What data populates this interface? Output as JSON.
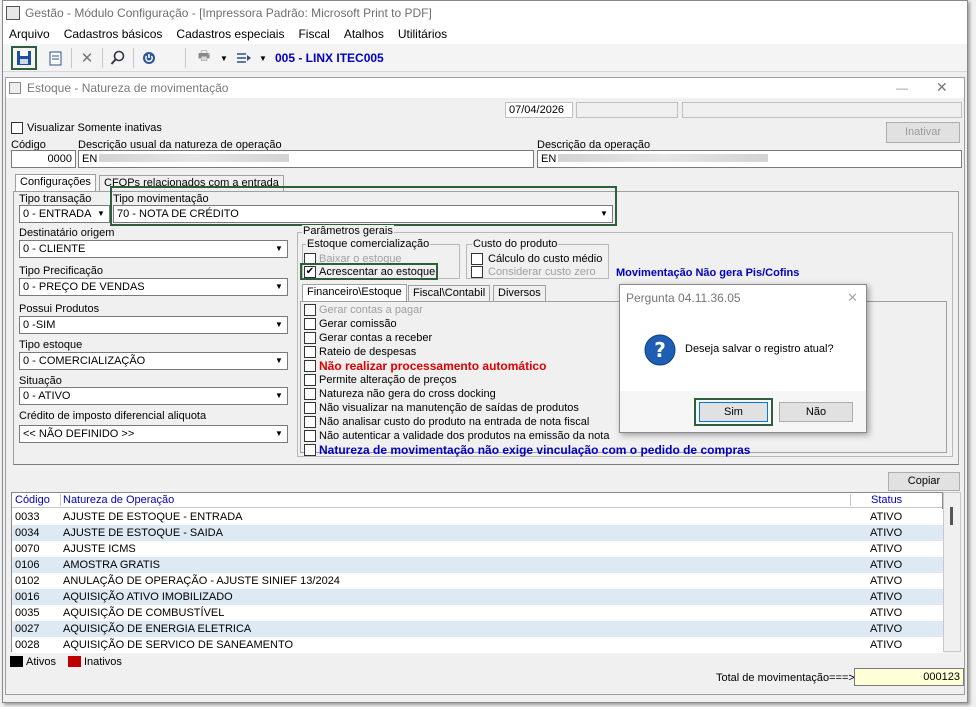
{
  "window": {
    "title": "Gestão - Módulo Configuração - [Impressora Padrão: Microsoft Print to PDF]"
  },
  "menu": [
    "Arquivo",
    "Cadastros básicos",
    "Cadastros especiais",
    "Fiscal",
    "Atalhos",
    "Utilitários"
  ],
  "toolbar": {
    "company": "005 - LINX ITEC005"
  },
  "child": {
    "title": "Estoque - Natureza de movimentação",
    "date": "07/04/2026"
  },
  "form": {
    "only_inactive": "Visualizar Somente inativas",
    "inactivate": "Inativar",
    "code_label": "Código",
    "code": "0000",
    "desc_usual_label": "Descrição usual da natureza de operação",
    "desc_usual": "EN",
    "desc_op_label": "Descrição da operação",
    "desc_op": "EN"
  },
  "tabs": {
    "config": "Configurações",
    "cfop": "CFOPs relacionados com a entrada"
  },
  "left": {
    "tipo_transacao_label": "Tipo transação",
    "tipo_transacao": "0 - ENTRADA",
    "tipo_mov_label": "Tipo movimentação",
    "tipo_mov": "70 - NOTA DE CRÉDITO",
    "dest_label": "Destinatário origem",
    "dest": "0 - CLIENTE",
    "prec_label": "Tipo Precificação",
    "prec": "0 - PREÇO DE VENDAS",
    "prod_label": "Possui Produtos",
    "prod": "0 -SIM",
    "estq_label": "Tipo estoque",
    "estq": "0 - COMERCIALIZAÇÃO",
    "sit_label": "Situação",
    "sit": "0 - ATIVO",
    "cred_label": "Crédito de imposto diferencial aliquota",
    "cred": "<< NÃO DEFINIDO >>"
  },
  "params": {
    "title": "Parâmetros gerais",
    "estoque_com": "Estoque comercialização",
    "baixar": "Baixar o estoque",
    "acrescentar": "Acrescentar ao estoque",
    "custo": "Custo do produto",
    "calc_custo": "Cálculo do custo médio",
    "cons_custo": "Considerar custo zero",
    "pis_note": "Movimentação Não gera Pis/Cofins"
  },
  "subtabs": [
    "Financeiro\\Estoque",
    "Fiscal\\Contabil",
    "Diversos"
  ],
  "checks": [
    {
      "label": "Gerar contas a pagar",
      "style": "grey"
    },
    {
      "label": "Gerar comissão",
      "style": "normal"
    },
    {
      "label": "Gerar contas a receber",
      "style": "normal"
    },
    {
      "label": "Rateio de despesas",
      "style": "normal"
    },
    {
      "label": "Não realizar processamento automático",
      "style": "red"
    },
    {
      "label": "Permite alteração de preços",
      "style": "normal"
    },
    {
      "label": "Natureza não gera do cross docking",
      "style": "normal"
    },
    {
      "label": "Não visualizar na manutenção de saídas de produtos",
      "style": "normal"
    },
    {
      "label": "Não analisar custo do produto na entrada de nota fiscal",
      "style": "normal"
    },
    {
      "label": "Não autenticar a validade dos produtos na emissão da nota",
      "style": "normal"
    },
    {
      "label": "Natureza de movimentação não exige vinculação com o pedido de compras",
      "style": "blue"
    }
  ],
  "dialog": {
    "title": "Pergunta 04.11.36.05",
    "message": "Deseja salvar o registro atual?",
    "yes": "Sim",
    "no": "Não"
  },
  "copy": "Copiar",
  "table": {
    "headers": [
      "Código",
      "Natureza de Operação",
      "Status"
    ],
    "rows": [
      [
        "0033",
        "AJUSTE DE ESTOQUE - ENTRADA",
        "ATIVO"
      ],
      [
        "0034",
        "AJUSTE DE ESTOQUE - SAIDA",
        "ATIVO"
      ],
      [
        "0070",
        "AJUSTE ICMS",
        "ATIVO"
      ],
      [
        "0106",
        "AMOSTRA GRATIS",
        "ATIVO"
      ],
      [
        "0102",
        "ANULAÇÃO DE OPERAÇÃO - AJUSTE SINIEF 13/2024",
        "ATIVO"
      ],
      [
        "0016",
        "AQUISIÇÃO ATIVO IMOBILIZADO",
        "ATIVO"
      ],
      [
        "0035",
        "AQUISIÇÃO DE COMBUSTÍVEL",
        "ATIVO"
      ],
      [
        "0027",
        "AQUISIÇÃO DE ENERGIA ELETRICA",
        "ATIVO"
      ],
      [
        "0028",
        "AQUISIÇÃO DE SERVICO DE SANEAMENTO",
        "ATIVO"
      ]
    ]
  },
  "legend": {
    "ativos": "Ativos",
    "inativos": "Inativos"
  },
  "total": {
    "label": "Total de movimentação===>",
    "value": "000123"
  },
  "colors": {
    "accent_blue": "#0000c0",
    "red": "#e00000",
    "row_highlight": "#dde9f3",
    "dialog_bg": "#f6f6f6"
  }
}
